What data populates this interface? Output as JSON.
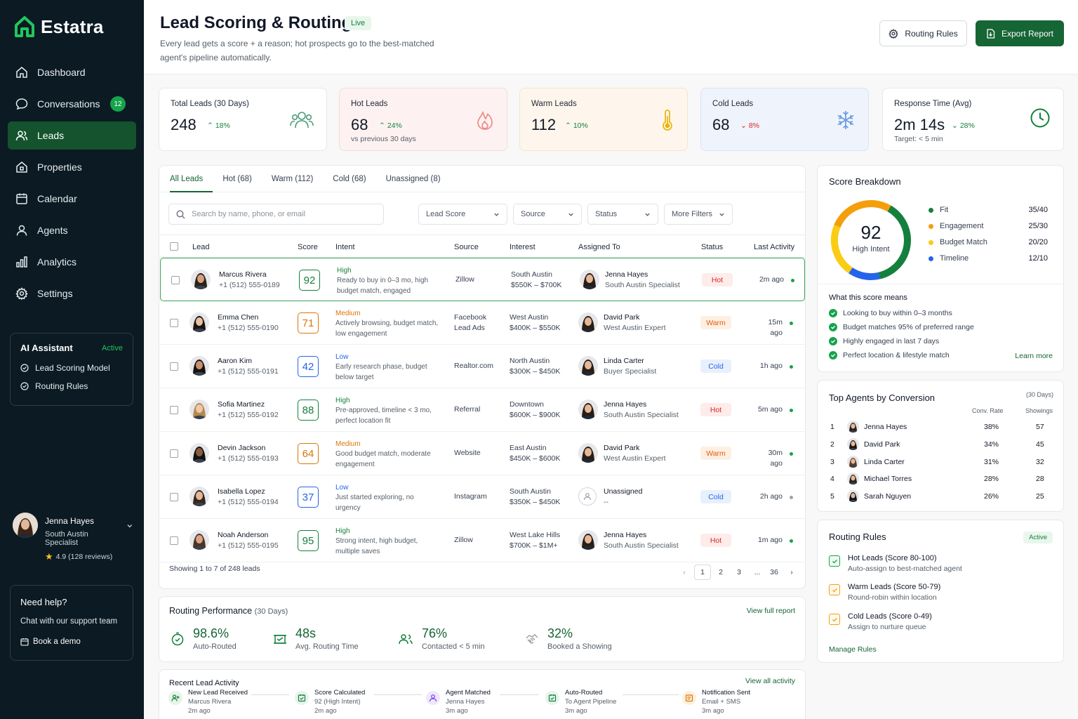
{
  "brand": {
    "name": "Estatra"
  },
  "nav": [
    {
      "label": "Dashboard",
      "icon": "home-icon"
    },
    {
      "label": "Conversations",
      "icon": "chat-icon",
      "badge": "12"
    },
    {
      "label": "Leads",
      "icon": "users-icon",
      "active": true
    },
    {
      "label": "Properties",
      "icon": "building-icon"
    },
    {
      "label": "Calendar",
      "icon": "calendar-icon"
    },
    {
      "label": "Agents",
      "icon": "user-icon"
    },
    {
      "label": "Analytics",
      "icon": "bar-chart-icon"
    },
    {
      "label": "Settings",
      "icon": "gear-icon"
    }
  ],
  "ai_assistant": {
    "title": "AI Assistant",
    "status": "Active",
    "items": [
      "Lead Scoring Model",
      "Routing Rules"
    ]
  },
  "user": {
    "name": "Jenna Hayes",
    "role": "South Austin Specialist",
    "rating": "4.9 (128 reviews)"
  },
  "help": {
    "title": "Need help?",
    "subtitle": "Chat with our support team",
    "demo": "Book a demo"
  },
  "header": {
    "title": "Lead Scoring & Routing",
    "badge": "Live",
    "subtitle": "Every lead gets a score + a reason; hot prospects go to the best-matched agent's pipeline automatically.",
    "routing_button": "Routing Rules",
    "export_button": "Export Report"
  },
  "stats": [
    {
      "label": "Total Leads (30 Days)",
      "value": "248",
      "delta": "18%",
      "direction": "up",
      "icon": "users-icon"
    },
    {
      "label": "Hot Leads",
      "value": "68",
      "delta": "24%",
      "direction": "up",
      "sub": "vs previous 30 days",
      "icon": "flame-icon"
    },
    {
      "label": "Warm Leads",
      "value": "112",
      "delta": "10%",
      "direction": "up",
      "icon": "thermometer-icon"
    },
    {
      "label": "Cold Leads",
      "value": "68",
      "delta": "8%",
      "direction": "down",
      "icon": "snowflake-icon"
    },
    {
      "label": "Response Time (Avg)",
      "value": "2m 14s",
      "delta": "28%",
      "direction": "down",
      "sub": "Target: < 5 min",
      "icon": "clock-icon"
    }
  ],
  "tabs": [
    "All Leads",
    "Hot (68)",
    "Warm (112)",
    "Cold (68)",
    "Unassigned (8)"
  ],
  "search": {
    "placeholder": "Search by name, phone, or email"
  },
  "filters": [
    "Lead Score",
    "Source",
    "Status",
    "More Filters"
  ],
  "table": {
    "headers": [
      "Lead",
      "Score",
      "Intent",
      "Source",
      "Interest",
      "Assigned To",
      "Status",
      "Last Activity"
    ],
    "rows": [
      {
        "name": "Marcus Rivera",
        "phone": "+1 (512) 555-0189",
        "score": "92",
        "intent": "High",
        "intent_desc": "Ready to buy in 0–3 mo, high budget match, engaged",
        "source": "Zillow",
        "area": "South Austin",
        "range": "$550K – $700K",
        "agent": "Jenna Hayes",
        "agent_role": "South Austin Specialist",
        "status": "Hot",
        "last": "2m ago"
      },
      {
        "name": "Emma Chen",
        "phone": "+1 (512) 555-0190",
        "score": "71",
        "intent": "Medium",
        "intent_desc": "Actively browsing, budget match, low engagement",
        "source": "Facebook Lead Ads",
        "area": "West Austin",
        "range": "$400K – $550K",
        "agent": "David Park",
        "agent_role": "West Austin Expert",
        "status": "Warm",
        "last": "15m ago"
      },
      {
        "name": "Aaron Kim",
        "phone": "+1 (512) 555-0191",
        "score": "42",
        "intent": "Low",
        "intent_desc": "Early research phase, budget below target",
        "source": "Realtor.com",
        "area": "North Austin",
        "range": "$300K – $450K",
        "agent": "Linda Carter",
        "agent_role": "Buyer Specialist",
        "status": "Cold",
        "last": "1h ago"
      },
      {
        "name": "Sofia Martinez",
        "phone": "+1 (512) 555-0192",
        "score": "88",
        "intent": "High",
        "intent_desc": "Pre-approved, timeline < 3 mo, perfect location fit",
        "source": "Referral",
        "area": "Downtown",
        "range": "$600K – $900K",
        "agent": "Jenna Hayes",
        "agent_role": "South Austin Specialist",
        "status": "Hot",
        "last": "5m ago"
      },
      {
        "name": "Devin Jackson",
        "phone": "+1 (512) 555-0193",
        "score": "64",
        "intent": "Medium",
        "intent_desc": "Good budget match, moderate engagement",
        "source": "Website",
        "area": "East Austin",
        "range": "$450K – $600K",
        "agent": "David Park",
        "agent_role": "West Austin Expert",
        "status": "Warm",
        "last": "30m ago"
      },
      {
        "name": "Isabella Lopez",
        "phone": "+1 (512) 555-0194",
        "score": "37",
        "intent": "Low",
        "intent_desc": "Just started exploring, no urgency",
        "source": "Instagram",
        "area": "South Austin",
        "range": "$350K – $450K",
        "agent": "Unassigned",
        "agent_role": "--",
        "status": "Cold",
        "last": "2h ago"
      },
      {
        "name": "Noah Anderson",
        "phone": "+1 (512) 555-0195",
        "score": "95",
        "intent": "High",
        "intent_desc": "Strong intent, high budget, multiple saves",
        "source": "Zillow",
        "area": "West Lake Hills",
        "range": "$700K – $1M+",
        "agent": "Jenna Hayes",
        "agent_role": "South Austin Specialist",
        "status": "Hot",
        "last": "1m ago"
      }
    ],
    "showing": "Showing 1 to 7 of 248 leads",
    "pages": [
      "1",
      "2",
      "3",
      "...",
      "36"
    ]
  },
  "performance": {
    "title": "Routing Performance",
    "period": "(30 Days)",
    "link": "View full report",
    "items": [
      {
        "value": "98.6%",
        "label": "Auto-Routed",
        "icon": "clock-check-icon"
      },
      {
        "value": "48s",
        "label": "Avg. Routing Time",
        "icon": "timer-icon"
      },
      {
        "value": "76%",
        "label": "Contacted < 5 min",
        "icon": "people-icon"
      },
      {
        "value": "32%",
        "label": "Booked a Showing",
        "icon": "handshake-icon"
      }
    ]
  },
  "activity": {
    "title": "Recent Lead Activity",
    "link": "View all activity",
    "steps": [
      {
        "title": "New Lead Received",
        "sub": "Marcus Rivera",
        "time": "2m ago",
        "icon": "user-plus-icon"
      },
      {
        "title": "Score Calculated",
        "sub": "92 (High Intent)",
        "time": "2m ago",
        "icon": "calculator-icon"
      },
      {
        "title": "Agent Matched",
        "sub": "Jenna Hayes",
        "time": "3m ago",
        "icon": "agent-icon"
      },
      {
        "title": "Auto-Routed",
        "sub": "To Agent Pipeline",
        "time": "3m ago",
        "icon": "route-icon"
      },
      {
        "title": "Notification Sent",
        "sub": "Email + SMS",
        "time": "3m ago",
        "icon": "bell-icon"
      }
    ]
  },
  "breakdown": {
    "title": "Score Breakdown",
    "score": "92",
    "score_label": "High Intent",
    "items": [
      {
        "label": "Fit",
        "value": "35/40",
        "color": "#15803d"
      },
      {
        "label": "Engagement",
        "value": "25/30",
        "color": "#f59e0b"
      },
      {
        "label": "Budget Match",
        "value": "20/20",
        "color": "#facc15"
      },
      {
        "label": "Timeline",
        "value": "12/10",
        "color": "#2563eb"
      }
    ],
    "meaning_title": "What this score means",
    "meanings": [
      "Looking to buy within 0–3 months",
      "Budget matches 95% of preferred range",
      "Highly engaged in last 7 days",
      "Perfect location & lifestyle match"
    ],
    "learn_more": "Learn more"
  },
  "top_agents": {
    "title": "Top Agents by Conversion",
    "period": "(30 Days)",
    "col1": "Conv. Rate",
    "col2": "Showings",
    "rows": [
      {
        "rank": "1",
        "name": "Jenna Hayes",
        "rate": "38%",
        "showings": "57"
      },
      {
        "rank": "2",
        "name": "David Park",
        "rate": "34%",
        "showings": "45"
      },
      {
        "rank": "3",
        "name": "Linda Carter",
        "rate": "31%",
        "showings": "32"
      },
      {
        "rank": "4",
        "name": "Michael Torres",
        "rate": "28%",
        "showings": "28"
      },
      {
        "rank": "5",
        "name": "Sarah Nguyen",
        "rate": "26%",
        "showings": "25"
      }
    ]
  },
  "rules": {
    "title": "Routing Rules",
    "status": "Active",
    "items": [
      {
        "title": "Hot Leads (Score 80-100)",
        "sub": "Auto-assign to best-matched agent",
        "color": "#16a34a"
      },
      {
        "title": "Warm Leads (Score 50-79)",
        "sub": "Round-robin within location",
        "color": "#f59e0b"
      },
      {
        "title": "Cold Leads (Score 0-49)",
        "sub": "Assign to nurture queue",
        "color": "#f59e0b"
      }
    ],
    "manage": "Manage Rules"
  },
  "colors": {
    "brand": "#166534",
    "hot": "#dc2626",
    "warm": "#ea580c",
    "cold": "#2563eb"
  }
}
